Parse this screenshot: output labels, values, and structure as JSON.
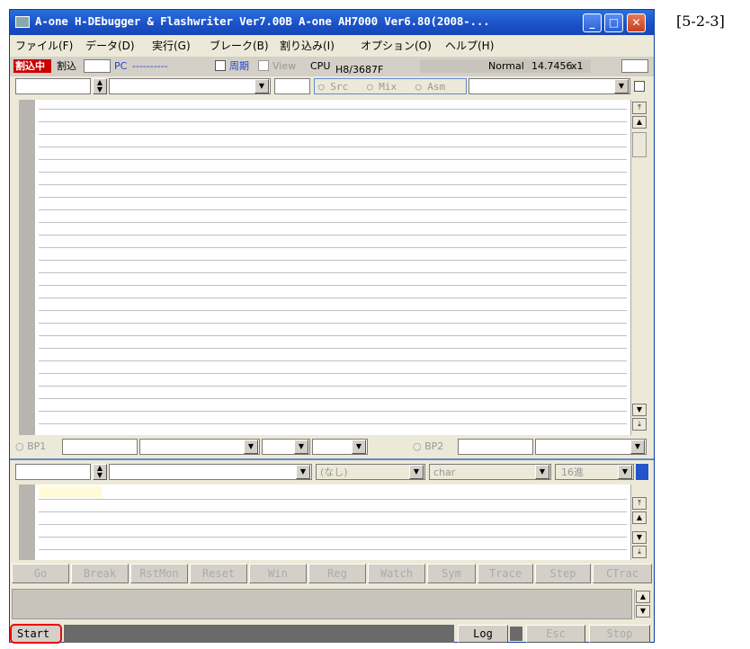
{
  "window": {
    "title": "A-one H-DEbugger & Flashwriter Ver7.00B A-one AH7000 Ver6.80(2008-...",
    "buttons": {
      "minimize": "_",
      "maximize": "□",
      "close": "✕"
    }
  },
  "figure_label": "[5-2-3]",
  "menu": [
    "ファイル(F)",
    "データ(D)",
    "実行(G)",
    "ブレーク(B)",
    "割り込み(I)",
    "オプション(O)",
    "ヘルプ(H)"
  ],
  "toolbar": {
    "status_label": "割込中",
    "interrupt": "割込",
    "pc_label": "PC",
    "pc_value": "----------",
    "period_label": "周期",
    "view_label": "View",
    "cpu_label": "CPU",
    "cpu_value": "H8/3687F",
    "mode": "Normal",
    "clock": "14.7456",
    "mult": "x1"
  },
  "source_bar": {
    "modes": [
      "Src",
      "Mix",
      "Asm"
    ]
  },
  "bp": {
    "bp1": "BP1",
    "bp2": "BP2"
  },
  "watch_bar": {
    "none": "(なし)",
    "type": "char",
    "radix": "16進"
  },
  "buttons": [
    "Go",
    "Break",
    "RstMon",
    "Reset",
    "Win",
    "Reg",
    "Watch",
    "Sym",
    "Trace",
    "Step",
    "CTrac"
  ],
  "bottom": {
    "start": "Start",
    "log": "Log",
    "esc": "Esc",
    "stop": "Stop"
  }
}
